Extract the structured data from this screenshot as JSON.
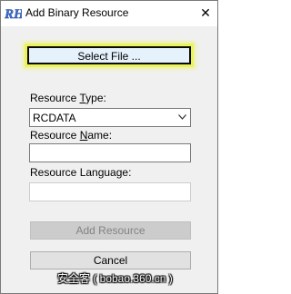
{
  "window": {
    "app_icon_text": "RH",
    "title": "Add Binary Resource",
    "close_glyph": "✕"
  },
  "buttons": {
    "select_file": "Select File ...",
    "add_resource": "Add Resource",
    "cancel": "Cancel"
  },
  "form": {
    "resource_type": {
      "label_prefix": "Resource ",
      "label_accel": "T",
      "label_suffix": "ype:",
      "value": "RCDATA"
    },
    "resource_name": {
      "label_prefix": "Resource ",
      "label_accel": "N",
      "label_suffix": "ame:",
      "value": ""
    },
    "resource_language": {
      "label": "Resource Language:",
      "value": ""
    }
  },
  "watermark": "安全客 ( bobao.360.cn )",
  "colors": {
    "app_icon": "#3a6fd1",
    "focus_highlight": "#ecf35a",
    "window_bg": "#f0f0f0"
  },
  "icons": {
    "app": "resource-hacker-logo",
    "close": "close-icon",
    "dropdown": "chevron-down-icon"
  }
}
